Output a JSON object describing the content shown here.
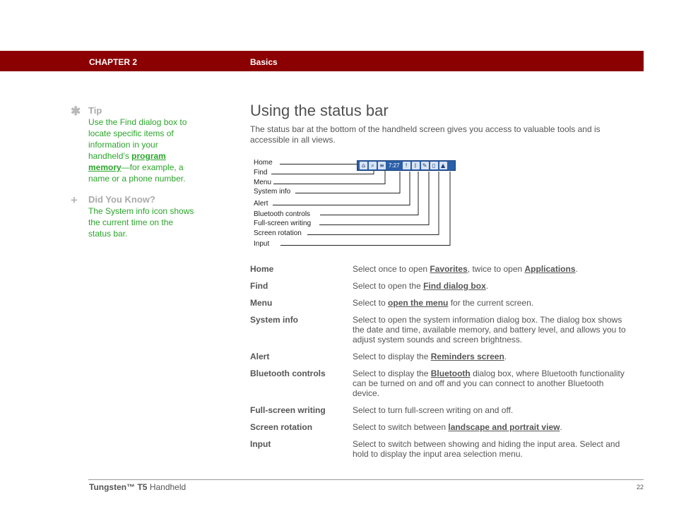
{
  "header": {
    "chapter": "CHAPTER 2",
    "section": "Basics"
  },
  "sidebar": {
    "tip": {
      "icon": "asterisk-icon",
      "heading": "Tip",
      "text_before": "Use the Find dialog box to locate specific items of information in your handheld’s ",
      "link": "program memory",
      "text_after": "—for example, a name or a phone number."
    },
    "did_you_know": {
      "icon": "plus-icon",
      "heading": "Did You Know?",
      "text": "The System info icon shows the current time on the status bar."
    }
  },
  "main": {
    "title": "Using the status bar",
    "intro": "The status bar at the bottom of the handheld screen gives you access to valuable tools and is accessible in all views.",
    "diagram": {
      "labels": [
        "Home",
        "Find",
        "Menu",
        "System info",
        "Alert",
        "Bluetooth controls",
        "Full-screen writing",
        "Screen rotation",
        "Input"
      ],
      "time": "7:27",
      "icons": [
        "home-icon",
        "find-icon",
        "menu-icon",
        "alert-icon",
        "bluetooth-icon",
        "full-screen-writing-icon",
        "screen-rotation-icon",
        "input-icon"
      ]
    },
    "definitions": [
      {
        "term": "Home",
        "parts": [
          "Select once to open ",
          "Favorites",
          ", twice to open ",
          "Applications",
          "."
        ]
      },
      {
        "term": "Find",
        "parts": [
          "Select to open the ",
          "Find dialog box",
          "."
        ]
      },
      {
        "term": "Menu",
        "parts": [
          "Select to ",
          "open the menu",
          " for the current screen."
        ]
      },
      {
        "term": "System info",
        "parts": [
          "Select to open the system information dialog box. The dialog box shows the date and time, available memory, and battery level, and allows you to adjust system sounds and screen brightness."
        ]
      },
      {
        "term": "Alert",
        "parts": [
          "Select to display the ",
          "Reminders screen",
          "."
        ]
      },
      {
        "term": "Bluetooth controls",
        "parts": [
          "Select to display the ",
          "Bluetooth",
          " dialog box, where Bluetooth functionality can be turned on and off and you can connect to another Bluetooth device."
        ]
      },
      {
        "term": "Full-screen writing",
        "parts": [
          "Select to turn full-screen writing on and off."
        ]
      },
      {
        "term": "Screen rotation",
        "parts": [
          "Select to switch between ",
          "landscape and portrait view",
          "."
        ]
      },
      {
        "term": "Input",
        "parts": [
          "Select to switch between showing and hiding the input area. Select and hold to display the input area selection menu."
        ]
      }
    ]
  },
  "footer": {
    "product_brand": "Tungsten™",
    "product_model": "T5",
    "product_type": "Handheld",
    "page_number": "22"
  },
  "colors": {
    "header_bar": "#8b0000",
    "sidebar_text": "#2ba52b",
    "status_bar": "#2b5fa8"
  }
}
